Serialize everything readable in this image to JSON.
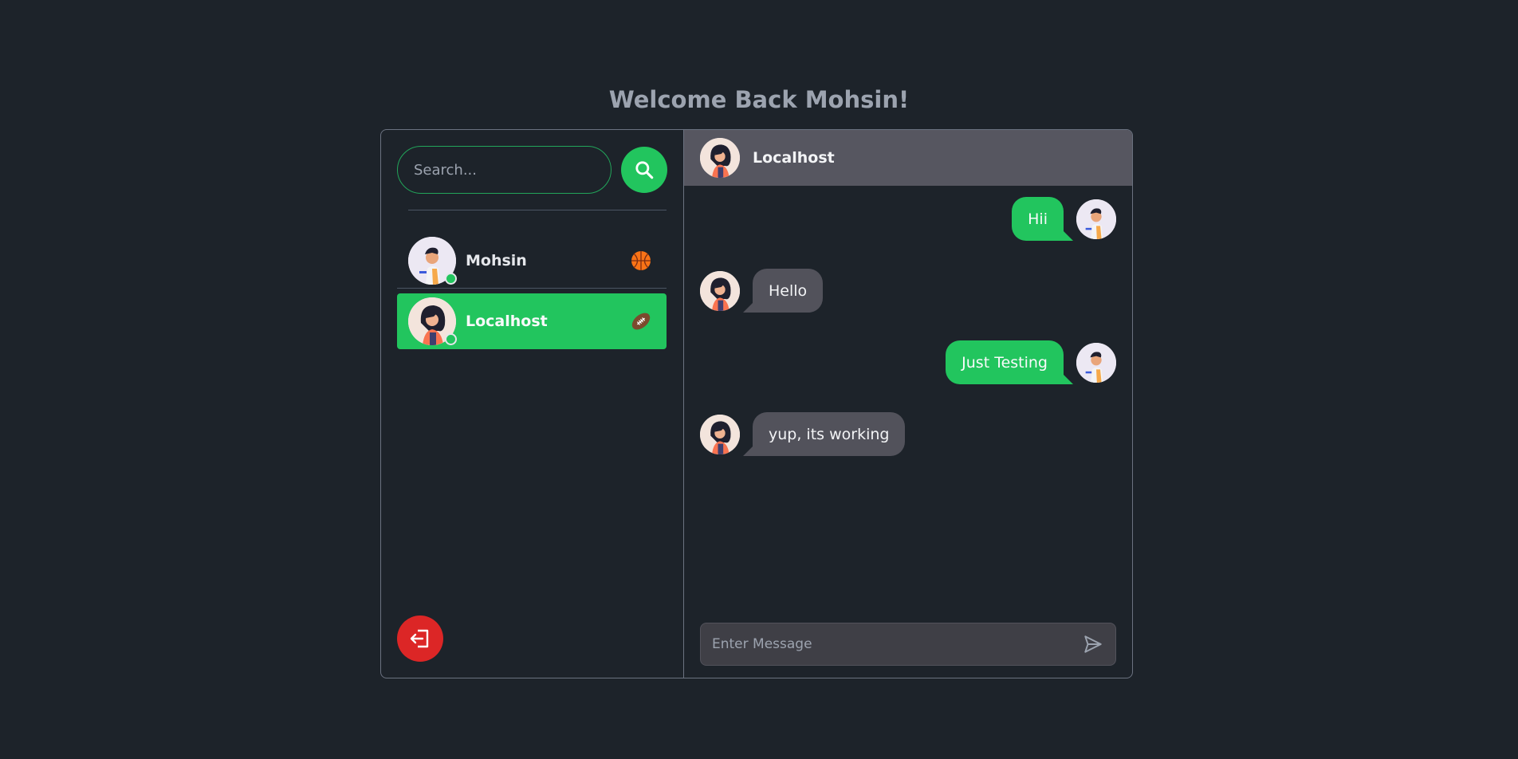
{
  "page": {
    "title": "Welcome Back Mohsin!"
  },
  "search": {
    "placeholder": "Search...",
    "button_icon": "search-icon"
  },
  "users": [
    {
      "name": "Mohsin",
      "online": true,
      "status_icon": "basketball-icon",
      "avatar": "male-avatar",
      "active": false
    },
    {
      "name": "Localhost",
      "online": true,
      "status_icon": "football-icon",
      "avatar": "female-avatar",
      "active": true
    }
  ],
  "logout": {
    "icon": "logout-icon"
  },
  "chat": {
    "header_name": "Localhost",
    "messages": [
      {
        "text": "Hii",
        "direction": "sent"
      },
      {
        "text": "Hello",
        "direction": "received"
      },
      {
        "text": "Just Testing",
        "direction": "sent"
      },
      {
        "text": "yup, its working",
        "direction": "received"
      }
    ],
    "composer_placeholder": "Enter Message",
    "send_icon": "send-icon"
  },
  "colors": {
    "background": "#1d232a",
    "accent": "#22c55e",
    "danger": "#dc2626",
    "received_bubble": "#52525b",
    "header": "#565660"
  }
}
